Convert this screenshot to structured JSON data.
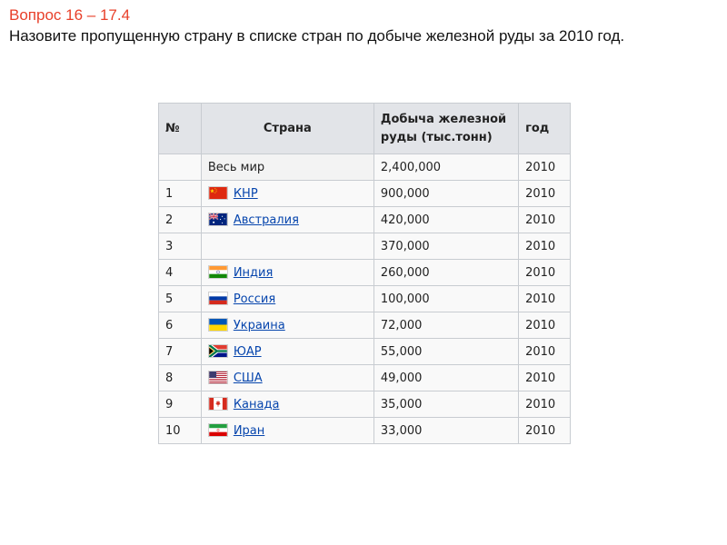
{
  "question": {
    "title": "Вопрос 16 – 17.4",
    "text": "Назовите пропущенную страну в списке стран по добыче железной руды за 2010 год."
  },
  "table": {
    "headers": {
      "num": "№",
      "country": "Страна",
      "production": "Добыча железной руды (тыс.тонн)",
      "year": "год"
    },
    "rows": [
      {
        "num": "",
        "country": "Весь мир",
        "flag": "",
        "production": "2,400,000",
        "year": "2010"
      },
      {
        "num": "1",
        "country": "КНР",
        "flag": "flag-china-icon",
        "production": "900,000",
        "year": "2010"
      },
      {
        "num": "2",
        "country": "Австралия",
        "flag": "flag-australia-icon",
        "production": "420,000",
        "year": "2010"
      },
      {
        "num": "3",
        "country": "",
        "flag": "",
        "production": "370,000",
        "year": "2010"
      },
      {
        "num": "4",
        "country": "Индия",
        "flag": "flag-india-icon",
        "production": "260,000",
        "year": "2010"
      },
      {
        "num": "5",
        "country": "Россия",
        "flag": "flag-russia-icon",
        "production": "100,000",
        "year": "2010"
      },
      {
        "num": "6",
        "country": "Украина",
        "flag": "flag-ukraine-icon",
        "production": "72,000",
        "year": "2010"
      },
      {
        "num": "7",
        "country": "ЮАР",
        "flag": "flag-south-africa-icon",
        "production": "55,000",
        "year": "2010"
      },
      {
        "num": "8",
        "country": "США",
        "flag": "flag-usa-icon",
        "production": "49,000",
        "year": "2010"
      },
      {
        "num": "9",
        "country": "Канада",
        "flag": "flag-canada-icon",
        "production": "35,000",
        "year": "2010"
      },
      {
        "num": "10",
        "country": "Иран",
        "flag": "flag-iran-icon",
        "production": "33,000",
        "year": "2010"
      }
    ]
  },
  "colors": {
    "title_accent": "#e8402a",
    "link": "#0645ad",
    "header_bg": "#e2e4e8",
    "border": "#c8ccd1"
  }
}
